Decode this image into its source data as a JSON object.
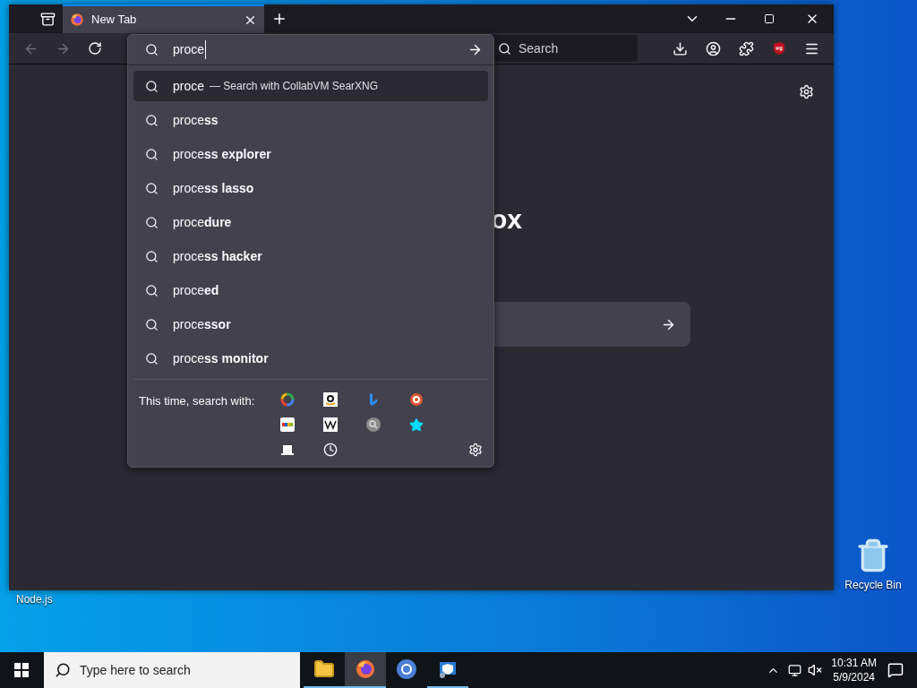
{
  "browser": {
    "tabs": [
      {
        "title": "New Tab",
        "selected": true
      }
    ],
    "address_bar": {
      "value": "proce"
    },
    "search_field": {
      "placeholder": "Search"
    },
    "page_heading": "ox",
    "suggestions": [
      {
        "text": "proce",
        "hint": "— Search with CollabVM SearXNG",
        "selected": true
      },
      {
        "text": "proce**ss**",
        "selected": false
      },
      {
        "text": "proce**ss explorer**",
        "selected": false
      },
      {
        "text": "proce**ss lasso**",
        "selected": false
      },
      {
        "text": "proce**dure**",
        "selected": false
      },
      {
        "text": "proce**ss hacker**",
        "selected": false
      },
      {
        "text": "proce**ed**",
        "selected": false
      },
      {
        "text": "proce**ssor**",
        "selected": false
      },
      {
        "text": "proce**ss monitor**",
        "selected": false
      }
    ],
    "search_with": {
      "label": "This time, search with:",
      "engines": [
        {
          "kind": "google"
        },
        {
          "kind": "amazon"
        },
        {
          "kind": "bing"
        },
        {
          "kind": "duck"
        },
        {
          "kind": "ebay"
        },
        {
          "kind": "wiki"
        },
        {
          "kind": "lens"
        },
        {
          "kind": "star"
        },
        {
          "kind": "tabs"
        },
        {
          "kind": "history"
        }
      ]
    }
  },
  "desktop_icons": [
    {
      "label": "Node.js"
    },
    {
      "label": "Recycle Bin"
    }
  ],
  "taskbar": {
    "search_placeholder": "Type here to search",
    "apps": [
      {
        "kind": "folder",
        "running": true,
        "selected": false
      },
      {
        "kind": "firefox",
        "running": true,
        "selected": true
      },
      {
        "kind": "chrome",
        "running": false,
        "selected": false
      },
      {
        "kind": "shield",
        "running": true,
        "selected": false
      }
    ],
    "time": "10:31 AM",
    "date": "5/9/2024"
  }
}
